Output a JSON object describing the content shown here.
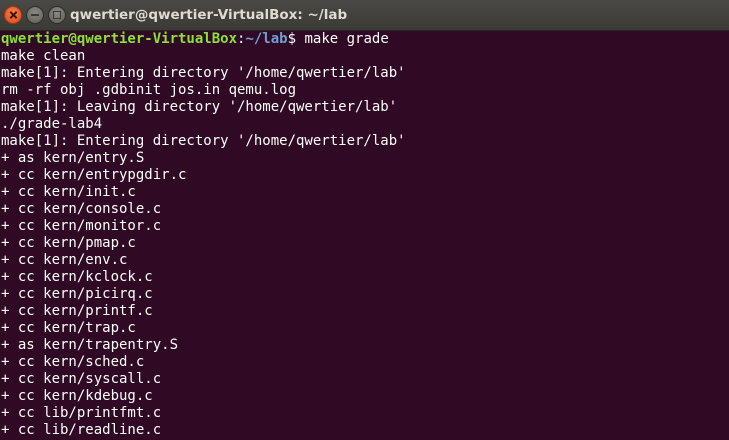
{
  "window": {
    "title": "qwertier@qwertier-VirtualBox: ~/lab"
  },
  "prompt": {
    "user_host": "qwertier@qwertier-VirtualBox",
    "sep": ":",
    "path": "~/lab",
    "symbol": "$",
    "command": " make grade"
  },
  "terminal": {
    "lines": [
      "make clean",
      "make[1]: Entering directory '/home/qwertier/lab'",
      "rm -rf obj .gdbinit jos.in qemu.log",
      "make[1]: Leaving directory '/home/qwertier/lab'",
      "./grade-lab4",
      "make[1]: Entering directory '/home/qwertier/lab'",
      "+ as kern/entry.S",
      "+ cc kern/entrypgdir.c",
      "+ cc kern/init.c",
      "+ cc kern/console.c",
      "+ cc kern/monitor.c",
      "+ cc kern/pmap.c",
      "+ cc kern/env.c",
      "+ cc kern/kclock.c",
      "+ cc kern/picirq.c",
      "+ cc kern/printf.c",
      "+ cc kern/trap.c",
      "+ as kern/trapentry.S",
      "+ cc kern/sched.c",
      "+ cc kern/syscall.c",
      "+ cc kern/kdebug.c",
      "+ cc lib/printfmt.c",
      "+ cc lib/readline.c"
    ]
  }
}
